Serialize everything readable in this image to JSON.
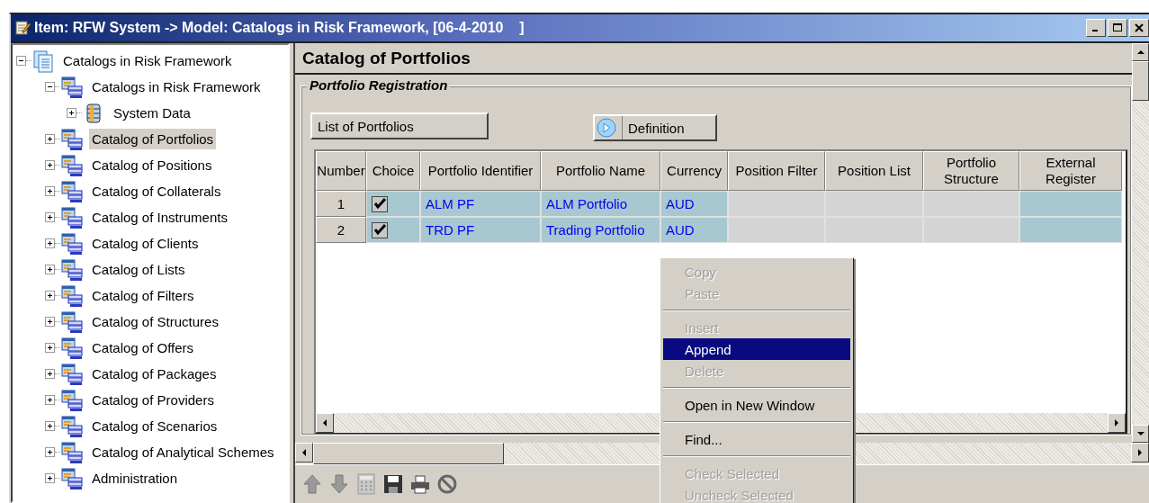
{
  "window": {
    "title": "Item: RFW System -> Model: Catalogs in Risk Framework, [06-4-2010    ]"
  },
  "tree": [
    {
      "label": "Catalogs in Risk Framework",
      "expanded": true,
      "selected": false,
      "children": [
        {
          "label": "Catalogs in Risk Framework",
          "expanded": true,
          "selected": false,
          "children": [
            {
              "label": "System Data",
              "expanded": false,
              "selected": false
            }
          ]
        },
        {
          "label": "Catalog of Portfolios",
          "expanded": false,
          "selected": true
        },
        {
          "label": "Catalog of Positions",
          "expanded": false,
          "selected": false
        },
        {
          "label": "Catalog of Collaterals",
          "expanded": false,
          "selected": false
        },
        {
          "label": "Catalog of Instruments",
          "expanded": false,
          "selected": false
        },
        {
          "label": "Catalog of Clients",
          "expanded": false,
          "selected": false
        },
        {
          "label": "Catalog of Lists",
          "expanded": false,
          "selected": false
        },
        {
          "label": "Catalog of Filters",
          "expanded": false,
          "selected": false
        },
        {
          "label": "Catalog of Structures",
          "expanded": false,
          "selected": false
        },
        {
          "label": "Catalog of Offers",
          "expanded": false,
          "selected": false
        },
        {
          "label": "Catalog of Packages",
          "expanded": false,
          "selected": false
        },
        {
          "label": "Catalog of Providers",
          "expanded": false,
          "selected": false
        },
        {
          "label": "Catalog of Scenarios",
          "expanded": false,
          "selected": false
        },
        {
          "label": "Catalog of Analytical Schemes",
          "expanded": false,
          "selected": false
        },
        {
          "label": "Administration",
          "expanded": false,
          "selected": false
        }
      ]
    }
  ],
  "panel": {
    "title": "Catalog of Portfolios",
    "group_title": "Portfolio Registration",
    "buttons": [
      {
        "label": "List of Portfolios",
        "kind": "plain"
      },
      {
        "label": "Definition",
        "kind": "play"
      }
    ],
    "table": {
      "columns": [
        "Number",
        "Choice",
        "Portfolio Identifier",
        "Portfolio Name",
        "Currency",
        "Position Filter",
        "Position List",
        "Portfolio Structure",
        "External Register"
      ],
      "rows": [
        {
          "number": "1",
          "checked": true,
          "selected": true,
          "identifier": "ALM PF",
          "name": "ALM Portfolio",
          "currency": "AUD"
        },
        {
          "number": "2",
          "checked": true,
          "selected": true,
          "identifier": "TRD PF",
          "name": "Trading Portfolio",
          "currency": "AUD"
        }
      ]
    }
  },
  "context_menu": [
    {
      "kind": "item",
      "label": "Copy",
      "disabled": true,
      "selected": false
    },
    {
      "kind": "item",
      "label": "Paste",
      "disabled": true,
      "selected": false
    },
    {
      "kind": "separator"
    },
    {
      "kind": "item",
      "label": "Insert",
      "disabled": true,
      "selected": false
    },
    {
      "kind": "item",
      "label": "Append",
      "disabled": false,
      "selected": true
    },
    {
      "kind": "item",
      "label": "Delete",
      "disabled": true,
      "selected": false
    },
    {
      "kind": "separator"
    },
    {
      "kind": "item",
      "label": "Open in New Window",
      "disabled": false,
      "selected": false
    },
    {
      "kind": "separator"
    },
    {
      "kind": "item",
      "label": "Find...",
      "disabled": false,
      "selected": false
    },
    {
      "kind": "separator"
    },
    {
      "kind": "item",
      "label": "Check Selected",
      "disabled": true,
      "selected": false
    },
    {
      "kind": "item",
      "label": "Uncheck Selected",
      "disabled": true,
      "selected": false
    }
  ]
}
